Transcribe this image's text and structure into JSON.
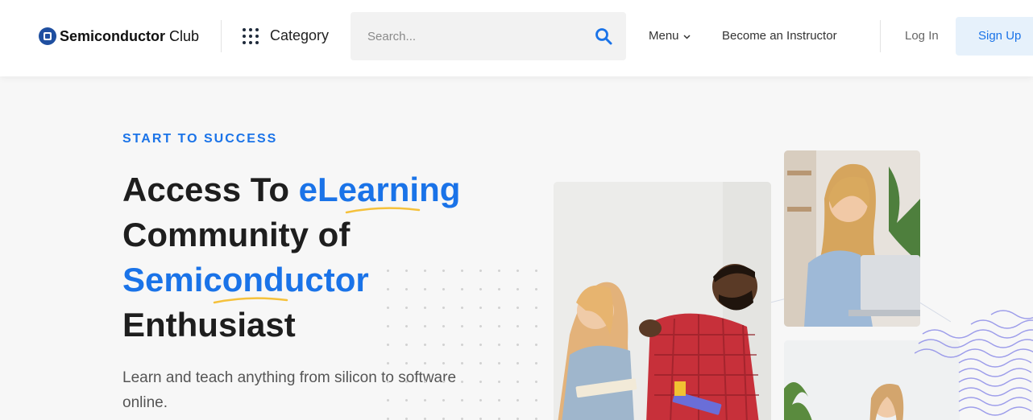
{
  "header": {
    "logo_bold": "Semiconductor",
    "logo_light": "Club",
    "category_label": "Category",
    "search_placeholder": "Search...",
    "menu_label": "Menu",
    "instructor_label": "Become an Instructor",
    "login_label": "Log In",
    "signup_label": "Sign Up"
  },
  "hero": {
    "eyebrow": "START TO SUCCESS",
    "line1_a": "Access To",
    "line1_b": "eLearning",
    "line2": "Community of",
    "line3": "Semiconductor",
    "line4": "Enthusiast",
    "lead": "Learn and teach anything from silicon to software online."
  },
  "colors": {
    "accent": "#1a73e8",
    "underline": "#f5c13b",
    "signup_bg": "#e6f1fb",
    "page_bg": "#f7f7f7"
  },
  "icons": [
    "chip-logo-icon",
    "grid-dots-icon",
    "search-icon",
    "chevron-down-icon"
  ],
  "images": [
    "two-people-talking-photo",
    "woman-laptop-photo",
    "woman-reading-photo"
  ]
}
